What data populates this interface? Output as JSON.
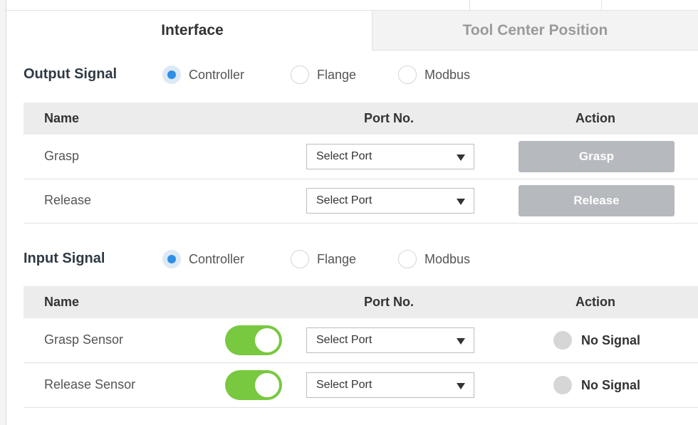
{
  "tabs": [
    {
      "label": "Interface",
      "active": true
    },
    {
      "label": "Tool Center Position",
      "active": false
    }
  ],
  "output_signal": {
    "title": "Output Signal",
    "options": [
      {
        "label": "Controller",
        "selected": true
      },
      {
        "label": "Flange",
        "selected": false
      },
      {
        "label": "Modbus",
        "selected": false
      }
    ],
    "columns": {
      "name": "Name",
      "port": "Port No.",
      "action": "Action"
    },
    "rows": [
      {
        "name": "Grasp",
        "port": "Select Port",
        "action": "Grasp"
      },
      {
        "name": "Release",
        "port": "Select Port",
        "action": "Release"
      }
    ]
  },
  "input_signal": {
    "title": "Input Signal",
    "options": [
      {
        "label": "Controller",
        "selected": true
      },
      {
        "label": "Flange",
        "selected": false
      },
      {
        "label": "Modbus",
        "selected": false
      }
    ],
    "columns": {
      "name": "Name",
      "port": "Port No.",
      "action": "Action"
    },
    "rows": [
      {
        "name": "Grasp Sensor",
        "enabled": true,
        "port": "Select Port",
        "status": "No Signal"
      },
      {
        "name": "Release Sensor",
        "enabled": true,
        "port": "Select Port",
        "status": "No Signal"
      }
    ]
  },
  "colors": {
    "accent": "#2f8fe8",
    "toggle_on": "#78c840",
    "button_disabled": "#b6b9bd",
    "status_off": "#d6d6d6"
  }
}
